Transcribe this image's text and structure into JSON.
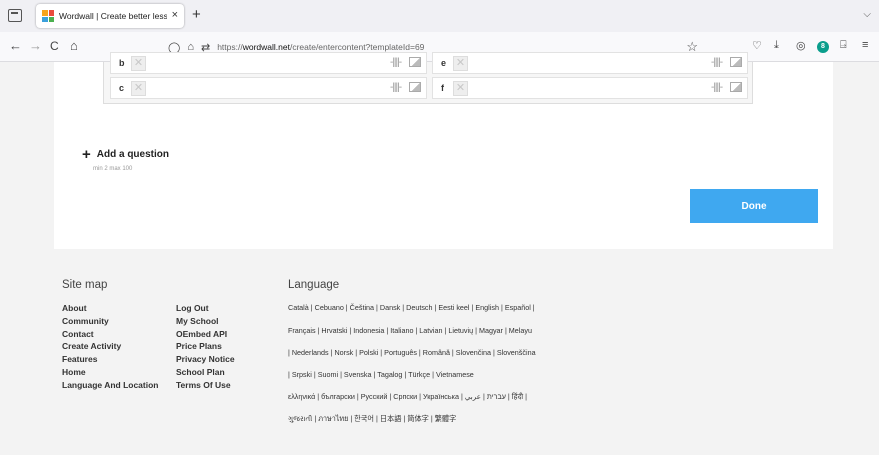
{
  "browser": {
    "tab_title": "Wordwall | Create better lessor",
    "tab_close": "×",
    "new_tab": "+",
    "url_prefix": "https://",
    "url_domain": "wordwall.net",
    "url_path": "/create/entercontent?templateId=69",
    "nav": {
      "back": "←",
      "forward": "→",
      "reload": "C",
      "home": "⌂"
    },
    "ext_badge": "8"
  },
  "editor": {
    "rows": [
      {
        "left": "b",
        "right": "e"
      },
      {
        "left": "c",
        "right": "f"
      }
    ],
    "add_question": "Add a question",
    "minmax": "min 2   max 100",
    "done_label": "Done"
  },
  "footer": {
    "site_map_title": "Site map",
    "site_map_col1": [
      "About",
      "Community",
      "Contact",
      "Create Activity",
      "Features",
      "Home",
      "Language And Location"
    ],
    "site_map_col2": [
      "Log Out",
      "My School",
      "OEmbed API",
      "Price Plans",
      "Privacy Notice",
      "School Plan",
      "Terms Of Use"
    ],
    "language_title": "Language",
    "language_lines": [
      "Català | Cebuano | Čeština | Dansk | Deutsch | Eesti keel | English | Español |",
      "Français | Hrvatski | Indonesia | Italiano | Latvian | Lietuvių | Magyar | Melayu",
      "| Nederlands | Norsk | Polski | Português | Română | Slovenčina | Slovenščina",
      "| Srpski | Suomi | Svenska | Tagalog | Türkçe | Vietnamese",
      "ελληνικά | български | Русский | Српски | Українська | עברית | عربي | हिंदी |",
      "ગુજરાતી | ภาษาไทย | 한국어 | 日本語 | 简体字 | 繁體字"
    ]
  }
}
